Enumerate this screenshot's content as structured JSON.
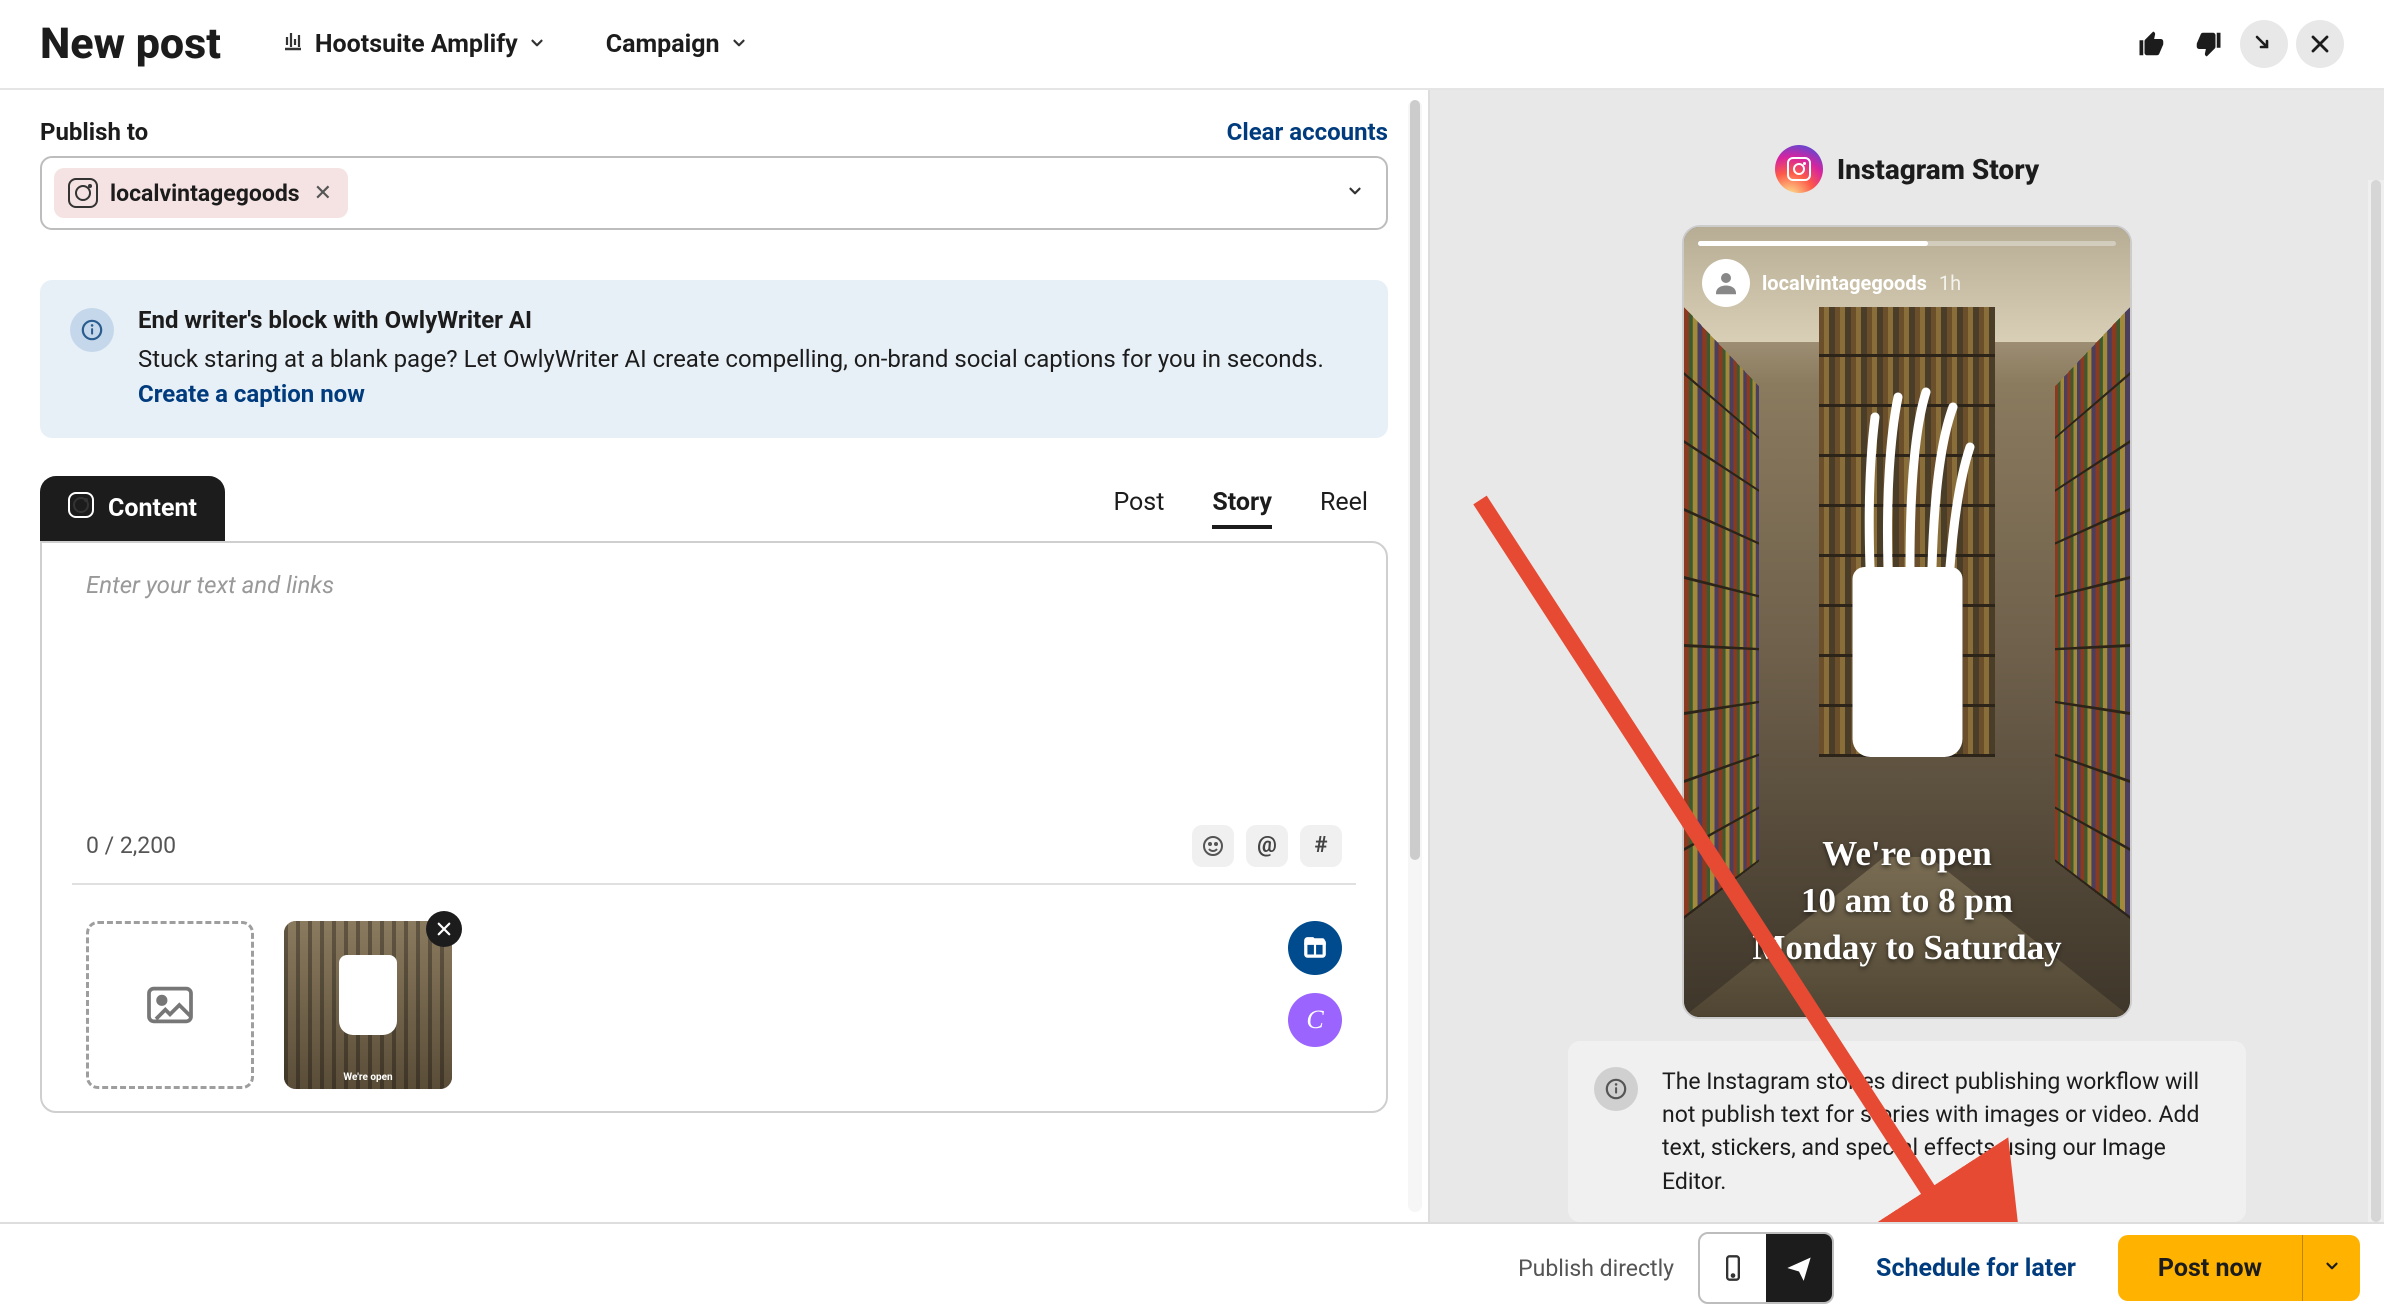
{
  "header": {
    "title": "New post",
    "amplify_label": "Hootsuite Amplify",
    "campaign_label": "Campaign"
  },
  "publish": {
    "label": "Publish to",
    "clear_label": "Clear accounts",
    "accounts": [
      {
        "name": "localvintagegoods",
        "network": "instagram"
      }
    ]
  },
  "banner": {
    "title": "End writer's block with OwlyWriter AI",
    "body": "Stuck staring at a blank page? Let OwlyWriter AI create compelling, on-brand social captions for you in seconds. ",
    "link": "Create a caption now"
  },
  "tabs": {
    "content_label": "Content",
    "types": [
      "Post",
      "Story",
      "Reel"
    ],
    "active_type": "Story"
  },
  "editor": {
    "placeholder": "Enter your text and links",
    "char_count": "0 / 2,200"
  },
  "preview": {
    "title": "Instagram Story",
    "username": "localvintagegoods",
    "time": "1h",
    "caption_line1": "We're open",
    "caption_line2": "10 am to 8 pm",
    "caption_line3": "Monday to Saturday",
    "note": "The Instagram stories direct publishing workflow will not publish text for stories with images or video. Add text, stickers, and special effects using our Image Editor."
  },
  "footer": {
    "publish_directly": "Publish directly",
    "schedule": "Schedule for later",
    "post_now": "Post now"
  }
}
